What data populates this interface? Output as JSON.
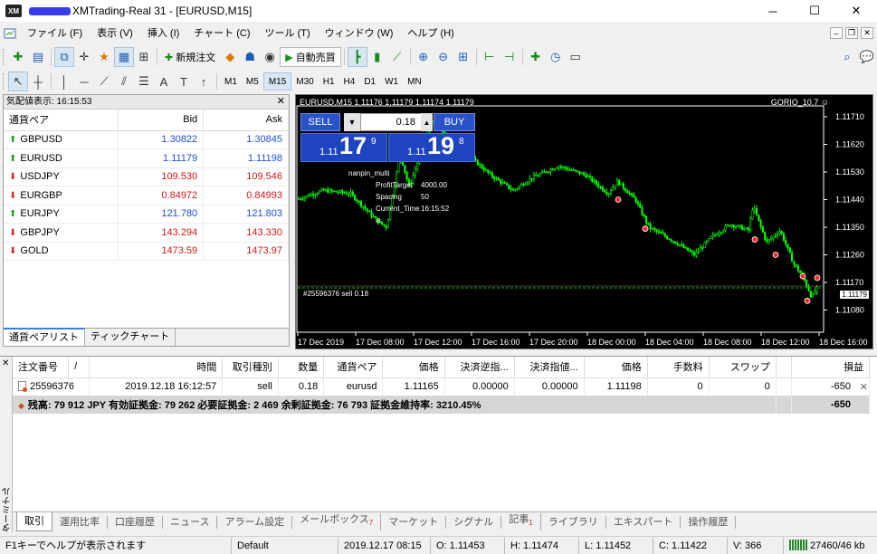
{
  "window": {
    "title": "XMTrading-Real 31 - [EURUSD,M15]",
    "min": "─",
    "max": "☐",
    "close": "✕"
  },
  "menu": [
    "ファイル (F)",
    "表示 (V)",
    "挿入 (I)",
    "チャート (C)",
    "ツール (T)",
    "ウィンドウ (W)",
    "ヘルプ (H)"
  ],
  "toolbar": {
    "new_order": "新規注文",
    "auto_trading": "自動売買",
    "timeframes": [
      "M1",
      "M5",
      "M15",
      "M30",
      "H1",
      "H4",
      "D1",
      "W1",
      "MN"
    ],
    "active_timeframe": "M15"
  },
  "market_watch": {
    "header": "気配値表示: 16:15:53",
    "columns": [
      "通貨ペア",
      "Bid",
      "Ask"
    ],
    "rows": [
      {
        "symbol": "GBPUSD",
        "bid": "1.30822",
        "ask": "1.30845",
        "dir": "up"
      },
      {
        "symbol": "EURUSD",
        "bid": "1.11179",
        "ask": "1.11198",
        "dir": "up"
      },
      {
        "symbol": "USDJPY",
        "bid": "109.530",
        "ask": "109.546",
        "dir": "down"
      },
      {
        "symbol": "EURGBP",
        "bid": "0.84972",
        "ask": "0.84993",
        "dir": "down"
      },
      {
        "symbol": "EURJPY",
        "bid": "121.780",
        "ask": "121.803",
        "dir": "up"
      },
      {
        "symbol": "GBPJPY",
        "bid": "143.294",
        "ask": "143.330",
        "dir": "down"
      },
      {
        "symbol": "GOLD",
        "bid": "1473.59",
        "ask": "1473.97",
        "dir": "down"
      }
    ],
    "tabs": [
      "通貨ペアリスト",
      "ティックチャート"
    ]
  },
  "chart": {
    "header": "EURUSD,M15  1.11176 1.11179 1.11174 1.11179",
    "ea_name": "GORIO_10.7",
    "one_click": {
      "sell": "SELL",
      "buy": "BUY",
      "volume": "0.18",
      "sell_small": "1.11",
      "sell_big": "17",
      "sell_sup": "9",
      "buy_small": "1.11",
      "buy_big": "19",
      "buy_sup": "8"
    },
    "ea_panel": {
      "name": "nanpin_multi",
      "rows": [
        {
          "k": "ProfitTarget",
          "v": "4000.00"
        },
        {
          "k": "Spacing",
          "v": "50"
        },
        {
          "k": "Current_Time is",
          "v": "16:15:52"
        }
      ]
    },
    "order_line": "#25596376 sell 0.18",
    "current_price": "1.11179",
    "price_labels": [
      "1.11710",
      "1.11620",
      "1.11530",
      "1.11440",
      "1.11350",
      "1.11260",
      "1.11170",
      "1.11080"
    ],
    "time_labels": [
      "17 Dec 2019",
      "17 Dec 08:00",
      "17 Dec 12:00",
      "17 Dec 16:00",
      "17 Dec 20:00",
      "18 Dec 00:00",
      "18 Dec 04:00",
      "18 Dec 08:00",
      "18 Dec 12:00",
      "18 Dec 16:00"
    ],
    "colors": {
      "bg": "#000000",
      "candle": "#00ff00",
      "grid": "#ffffff"
    }
  },
  "terminal": {
    "side_label": "ターミナル",
    "columns": [
      "注文番号",
      "/",
      "時間",
      "取引種別",
      "数量",
      "通貨ペア",
      "価格",
      "決済逆指...",
      "決済指値...",
      "価格",
      "手数料",
      "スワップ",
      "",
      "損益"
    ],
    "order": {
      "ticket": "25596376",
      "time": "2019.12.18 16:12:57",
      "type": "sell",
      "volume": "0.18",
      "symbol": "eurusd",
      "price": "1.11165",
      "sl": "0.00000",
      "tp": "0.00000",
      "current": "1.11198",
      "commission": "0",
      "swap": "0",
      "profit": "-650"
    },
    "balance_text": "残高: 79 912 JPY  有効証拠金: 79 262  必要証拠金: 2 469  余剰証拠金: 76 793  証拠金維持率: 3210.45%",
    "balance_profit": "-650",
    "tabs": [
      "取引",
      "運用比率",
      "口座履歴",
      "ニュース",
      "アラーム設定",
      "メールボックス",
      "マーケット",
      "シグナル",
      "記事",
      "ライブラリ",
      "エキスパート",
      "操作履歴"
    ],
    "mailbox_badge": "7",
    "articles_badge": "1"
  },
  "status": {
    "help": "F1キーでヘルプが表示されます",
    "profile": "Default",
    "datetime": "2019.12.17 08:15",
    "open": "O: 1.11453",
    "high": "H: 1.11474",
    "low": "L: 1.11452",
    "close": "C: 1.11422",
    "volume": "V: 366",
    "traffic": "27460/46 kb"
  }
}
